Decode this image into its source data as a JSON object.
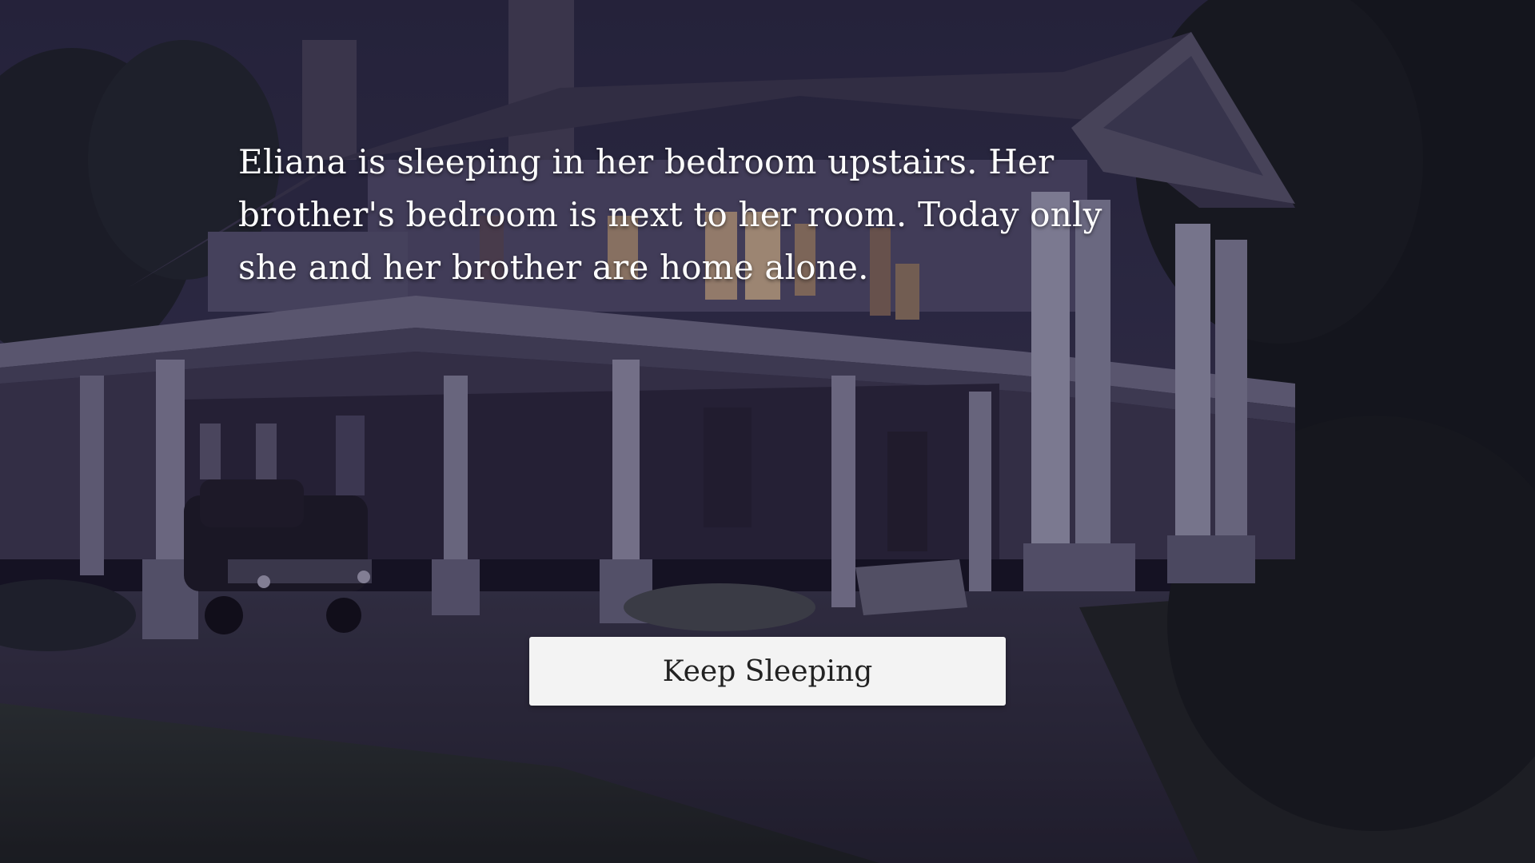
{
  "scene": {
    "background": "night-house-scene",
    "narration": "Eliana is sleeping in her bedroom upstairs. Her brother's bedroom is next to her room. Today only she and her brother are home alone."
  },
  "choices": [
    {
      "label": "Keep Sleeping"
    }
  ],
  "colors": {
    "overlay_tint": "#161230",
    "button_bg": "#f3f3f3",
    "button_text": "#222222",
    "narration_text": "#ffffff"
  }
}
